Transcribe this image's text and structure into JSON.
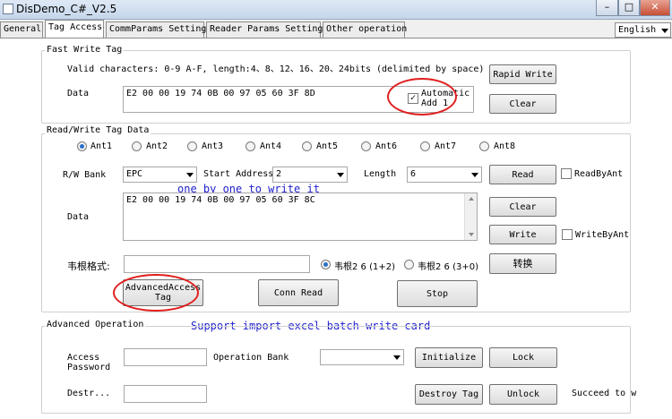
{
  "window": {
    "title": "DisDemo_C#_V2.5"
  },
  "tabs": [
    "General",
    "Tag Access",
    "CommParams Setting",
    "Reader Params Setting",
    "Other operation"
  ],
  "language": "English",
  "fast_write": {
    "title": "Fast Write Tag",
    "valid_chars": "Valid characters: 0-9 A-F, length:4、8、12、16、20、24bits (delimited by space)",
    "data_label": "Data",
    "data_value": "E2 00 00 19 74 0B 00 97 05 60 3F 8D",
    "auto_add_line1": "Automatic",
    "auto_add_line2": "Add 1",
    "auto_add_checked": true,
    "rapid_write": "Rapid Write",
    "clear": "Clear"
  },
  "rw": {
    "title": "Read/Write Tag Data",
    "antennas": [
      "Ant1",
      "Ant2",
      "Ant3",
      "Ant4",
      "Ant5",
      "Ant6",
      "Ant7",
      "Ant8"
    ],
    "selected_antenna": "Ant1",
    "bank_label": "R/W Bank",
    "bank_value": "EPC",
    "start_label": "Start Address",
    "start_value": "2",
    "length_label": "Length",
    "length_value": "6",
    "read": "Read",
    "read_by_ant": "ReadByAnt",
    "data_label": "Data",
    "data_value": "E2 00 00 19 74 0B 00 97 05 60 3F 8C",
    "clear": "Clear",
    "write": "Write",
    "write_by_ant": "WriteByAnt",
    "wiegand_label": "韦根格式:",
    "wiegand_opt1": "韦根2 6 (1+2)",
    "wiegand_opt2": "韦根2 6 (3+0)",
    "convert": "转换",
    "advanced_line1": "AdvancedAccess",
    "advanced_line2": "Tag",
    "conn_read": "Conn Read",
    "stop": "Stop"
  },
  "annotations": {
    "one_by_one": "one by one to write it",
    "support_import": "Support import excel batch write card"
  },
  "advanced": {
    "title": "Advanced Operation",
    "access_line1": "Access",
    "access_line2": "Password",
    "operation_bank": "Operation Bank",
    "initialize": "Initialize",
    "lock": "Lock",
    "destr_label": "Destr...",
    "destroy_tag": "Destroy Tag",
    "unlock": "Unlock",
    "status": "Succeed to w"
  },
  "colors": {
    "annotation": "#2222cc",
    "highlight_oval": "#e02020",
    "radio_selected": "#2b6fc7"
  }
}
